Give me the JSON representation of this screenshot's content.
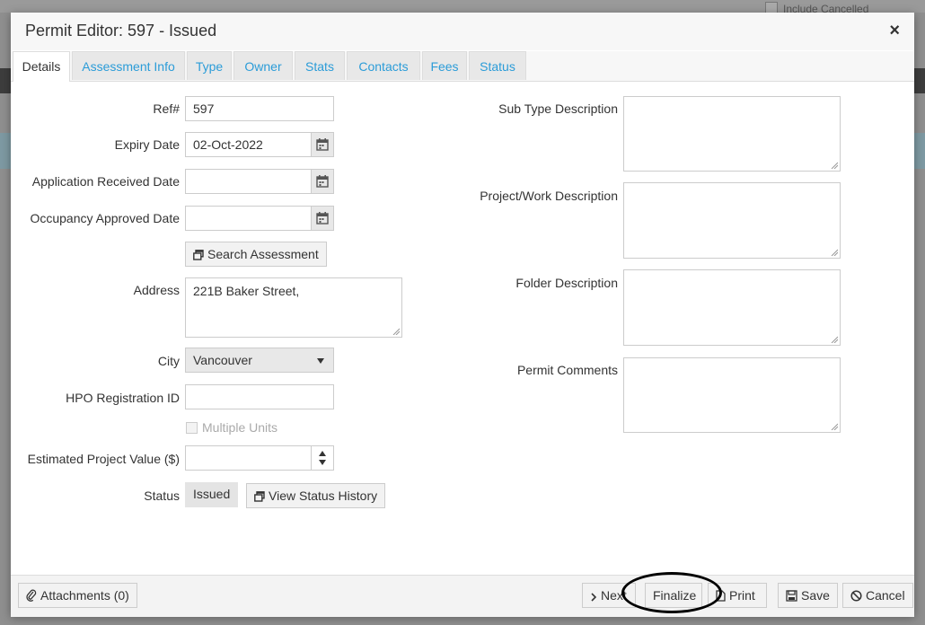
{
  "background": {
    "include_cancelled_label": "Include Cancelled"
  },
  "dialog": {
    "title": "Permit Editor: 597 - Issued",
    "close_label": "×"
  },
  "tabs": [
    {
      "label": "Details",
      "active": true
    },
    {
      "label": "Assessment Info"
    },
    {
      "label": "Type"
    },
    {
      "label": "Owner"
    },
    {
      "label": "Stats"
    },
    {
      "label": "Contacts"
    },
    {
      "label": "Fees"
    },
    {
      "label": "Status"
    }
  ],
  "form": {
    "ref": {
      "label": "Ref#",
      "value": "597"
    },
    "expiry": {
      "label": "Expiry Date",
      "value": "02-Oct-2022"
    },
    "app_received": {
      "label": "Application Received Date",
      "value": ""
    },
    "occupancy": {
      "label": "Occupancy Approved Date",
      "value": ""
    },
    "search_assessment_label": "Search Assessment",
    "address": {
      "label": "Address",
      "value": "221B Baker Street,"
    },
    "city": {
      "label": "City",
      "value": "Vancouver"
    },
    "hpo": {
      "label": "HPO Registration ID",
      "value": ""
    },
    "multiple_units_label": "Multiple Units",
    "estimated_value": {
      "label": "Estimated Project Value ($)",
      "value": ""
    },
    "status": {
      "label": "Status",
      "value": "Issued"
    },
    "view_status_history_label": "View Status History",
    "sub_type_desc": {
      "label": "Sub Type Description",
      "value": ""
    },
    "project_desc": {
      "label": "Project/Work Description",
      "value": ""
    },
    "folder_desc": {
      "label": "Folder Description",
      "value": ""
    },
    "permit_comments": {
      "label": "Permit Comments",
      "value": ""
    }
  },
  "footer": {
    "attachments_label": "Attachments (0)",
    "next_label": "Next",
    "finalize_label": "Finalize",
    "print_label": "Print",
    "save_label": "Save",
    "cancel_label": "Cancel"
  },
  "colors": {
    "tab_link": "#2b9cd8",
    "highlight": "#000000"
  }
}
